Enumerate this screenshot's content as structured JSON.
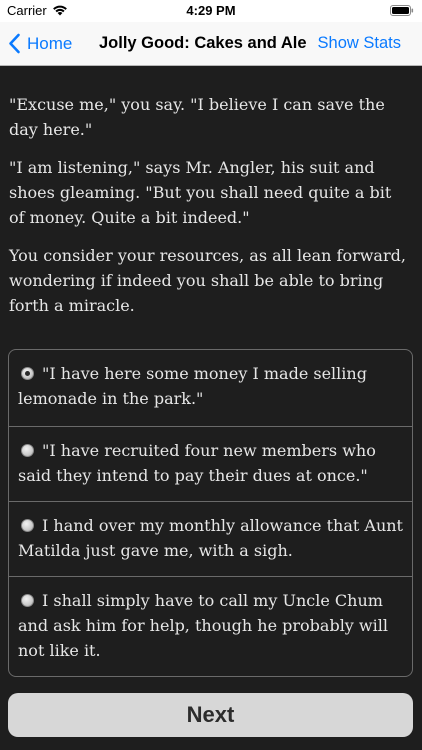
{
  "status_bar": {
    "carrier": "Carrier",
    "time": "4:29 PM",
    "wifi_icon": "wifi-icon",
    "battery_icon": "battery-icon"
  },
  "nav": {
    "back_label": "Home",
    "back_icon": "chevron-left-icon",
    "title": "Jolly Good: Cakes and Ale",
    "right_button": "Show Stats",
    "accent_color": "#0a7aff"
  },
  "story": {
    "paragraphs": [
      "\"Excuse me,\" you say. \"I believe I can save the day here.\"",
      "\"I am listening,\" says Mr. Angler, his suit and shoes gleaming. \"But you shall need quite a bit of money. Quite a bit indeed.\"",
      "You consider your resources, as all lean forward, wondering if indeed you shall be able to bring forth a miracle."
    ]
  },
  "choices": [
    {
      "text": "\"I have here some money I made selling lemonade in the park.\"",
      "selected": true
    },
    {
      "text": "\"I have recruited four new members who said they intend to pay their dues at once.\"",
      "selected": false
    },
    {
      "text": "I hand over my monthly allowance that Aunt Matilda just gave me, with a sigh.",
      "selected": false
    },
    {
      "text": "I shall simply have to call my Uncle Chum and ask him for help, though he probably will not like it.",
      "selected": false
    }
  ],
  "next_label": "Next"
}
